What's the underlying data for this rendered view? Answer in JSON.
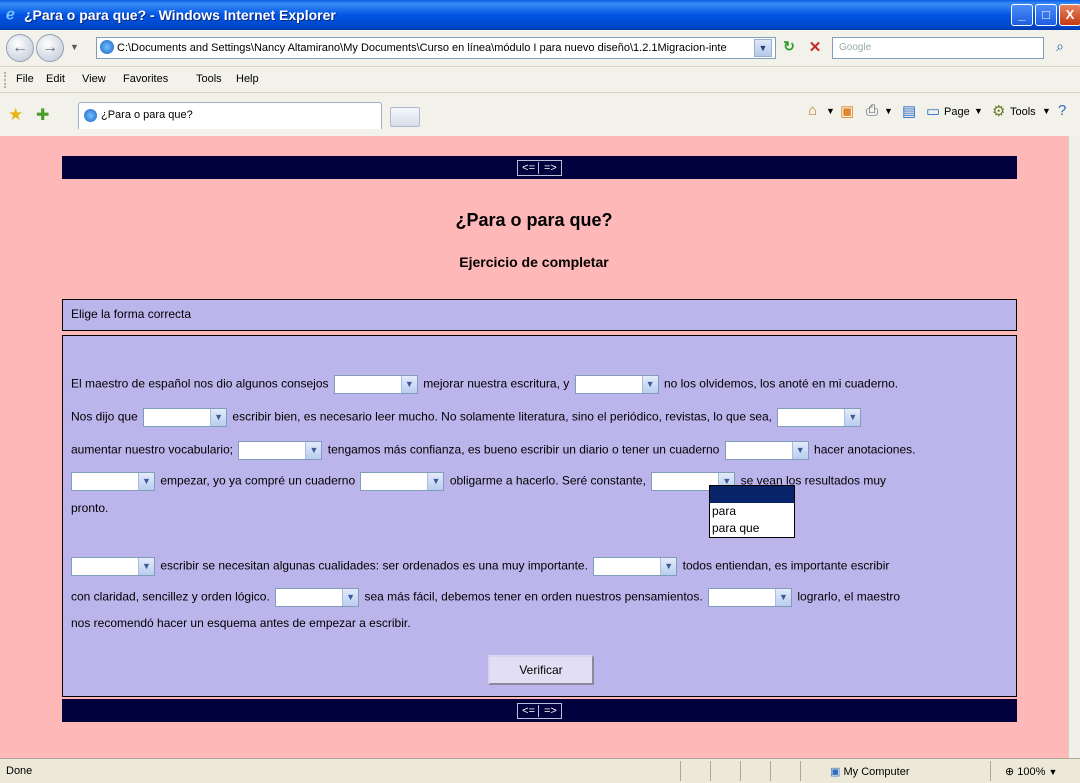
{
  "window": {
    "title": "¿Para o para que? - Windows Internet Explorer",
    "minimize_glyph": "_",
    "maximize_glyph": "□",
    "close_glyph": "X"
  },
  "address_bar": {
    "url": "C:\\Documents and Settings\\Nancy Altamirano\\My Documents\\Curso en línea\\módulo I para nuevo diseño\\1.2.1Migracion-inte",
    "search_placeholder": "Google"
  },
  "menu": [
    "File",
    "Edit",
    "View",
    "Favorites",
    "Tools",
    "Help"
  ],
  "tab": {
    "label": "¿Para o para que?"
  },
  "command_bar": {
    "page_label": "Page",
    "tools_label": "Tools"
  },
  "page": {
    "nav_prev": "<=",
    "nav_next": "=>",
    "title": "¿Para o para que?",
    "subtitle": "Ejercicio de completar",
    "instructions": "Elige la forma correcta",
    "paragraph1": {
      "l1": [
        "El maestro de español nos dio algunos consejos",
        "mejorar nuestra escritura, y",
        "no los olvidemos, los anoté en mi cuaderno."
      ],
      "l2": [
        "Nos dijo que",
        "escribir bien, es necesario leer mucho. No solamente literatura, sino el periódico, revistas, lo que sea,"
      ],
      "l3": [
        "aumentar nuestro vocabulario;",
        "tengamos más confianza, es bueno escribir un diario o tener un cuaderno",
        "hacer anotaciones."
      ],
      "l4": [
        "empezar, yo ya compré un cuaderno",
        "obligarme a hacerlo. Seré constante,",
        "se vean los resultados muy"
      ],
      "l5": "pronto."
    },
    "paragraph2": {
      "l1": [
        "escribir se necesitan algunas cualidades: ser ordenados es una muy importante.",
        "todos entiendan, es importante escribir"
      ],
      "l2": [
        "con claridad, sencillez y orden lógico.",
        "sea más fácil, debemos tener en orden nuestros pensamientos.",
        "lograrlo, el maestro"
      ],
      "l3": "nos recomendó hacer un esquema antes de empezar a escribir."
    },
    "dropdown_options": [
      "",
      "para",
      "para que"
    ],
    "verify_button": "Verificar"
  },
  "status_bar": {
    "left": "Done",
    "zone": "My Computer",
    "zoom": "100%"
  }
}
